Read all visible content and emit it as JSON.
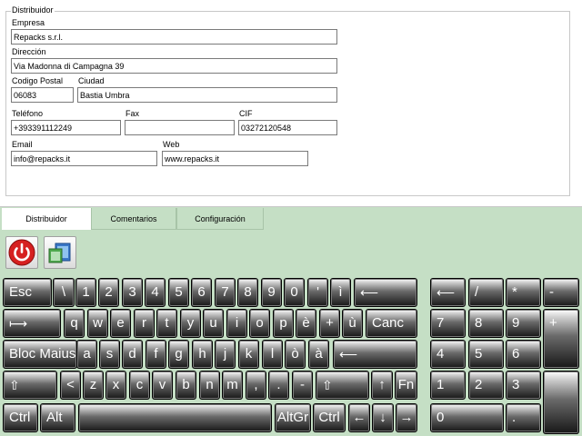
{
  "form": {
    "group_title": "Distribuidor",
    "empresa": {
      "label": "Empresa",
      "value": "Repacks s.r.l."
    },
    "direccion": {
      "label": "Dirección",
      "value": "Via Madonna di Campagna 39"
    },
    "codigo_postal": {
      "label": "Codigo Postal",
      "value": "06083"
    },
    "ciudad": {
      "label": "Ciudad",
      "value": "Bastia Umbra"
    },
    "telefono": {
      "label": "Teléfono",
      "value": "+393391112249"
    },
    "fax": {
      "label": "Fax",
      "value": ""
    },
    "cif": {
      "label": "CIF",
      "value": "03272120548"
    },
    "email": {
      "label": "Email",
      "value": "info@repacks.it"
    },
    "web": {
      "label": "Web",
      "value": "www.repacks.it"
    }
  },
  "tabs": [
    {
      "label": "Distribuidor",
      "active": true
    },
    {
      "label": "Comentarios",
      "active": false
    },
    {
      "label": "Configuración",
      "active": false
    }
  ],
  "toolbar": {
    "power_icon": "power-icon",
    "window_icon": "window-switch-icon"
  },
  "keyboard": {
    "row1": [
      "Esc",
      "\\",
      "1",
      "2",
      "3",
      "4",
      "5",
      "6",
      "7",
      "8",
      "9",
      "0",
      "'",
      "ì",
      "⟵"
    ],
    "row2": [
      "⟼",
      "q",
      "w",
      "e",
      "r",
      "t",
      "y",
      "u",
      "i",
      "o",
      "p",
      "è",
      "+",
      "ù",
      "Canc"
    ],
    "row3": [
      "Bloc Maiusc",
      "a",
      "s",
      "d",
      "f",
      "g",
      "h",
      "j",
      "k",
      "l",
      "ò",
      "à",
      "⟵"
    ],
    "row4": [
      "⇧",
      "<",
      "z",
      "x",
      "c",
      "v",
      "b",
      "n",
      "m",
      ",",
      ".",
      "-",
      "⇧",
      "↑",
      "Fn"
    ],
    "row5": [
      "Ctrl",
      "Alt",
      "",
      "AltGr",
      "Ctrl",
      "←",
      "↓",
      "→"
    ],
    "numpad": {
      "row1": [
        "⟵",
        "/",
        "*",
        "-"
      ],
      "row2": [
        "7",
        "8",
        "9",
        "+"
      ],
      "row3": [
        "4",
        "5",
        "6"
      ],
      "row4": [
        "1",
        "2",
        "3",
        ""
      ],
      "row5": [
        "0",
        "."
      ]
    }
  },
  "colors": {
    "background": "#c5dfc5",
    "panel": "#ffffff",
    "key_dark": "#181818",
    "power_red": "#d62020"
  }
}
